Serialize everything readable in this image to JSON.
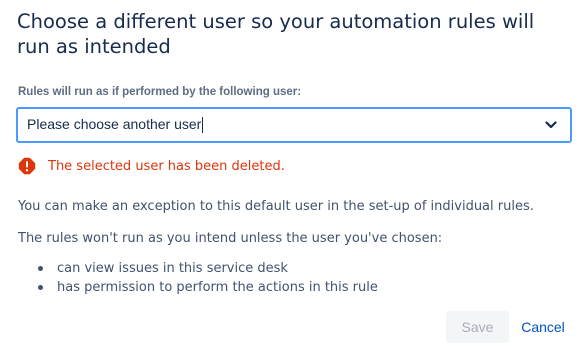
{
  "dialog": {
    "title": "Choose a different user so your automation rules will run as intended"
  },
  "user_field": {
    "label": "Rules will run as if performed by the following user:",
    "value": "Please choose another user",
    "border_color": "#4c9aff"
  },
  "error": {
    "icon": "error-icon",
    "message": "The selected user has been deleted.",
    "color": "#de350b"
  },
  "info": {
    "paragraph1": "You can make an exception to this default user in the set-up of individual rules.",
    "paragraph2": "The rules won't run as you intend unless the user you've chosen:",
    "bullets": [
      "can view issues in this service desk",
      "has permission to perform the actions in this rule"
    ]
  },
  "footer": {
    "save_label": "Save",
    "save_disabled": true,
    "cancel_label": "Cancel",
    "link_color": "#0052cc"
  }
}
